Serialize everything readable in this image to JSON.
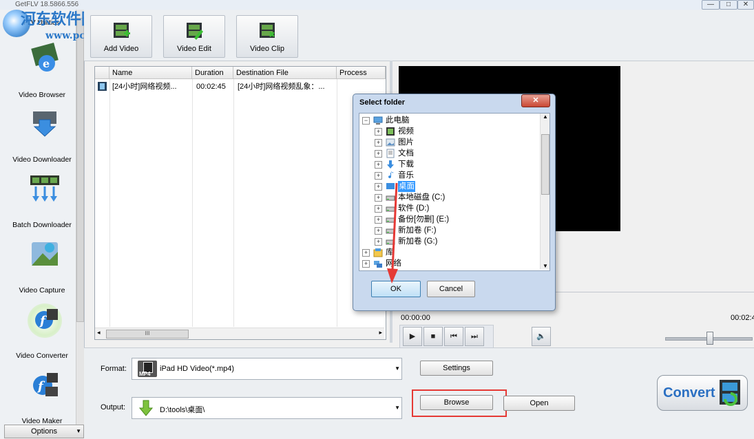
{
  "window": {
    "title": "GetFLV 18.5866.556",
    "watermark_cn": "河东软件园",
    "watermark_url": "www.pc0359.cn",
    "controls": [
      "—",
      "□",
      "✕"
    ]
  },
  "sidebar": {
    "header": "FLV Utilities",
    "items": [
      {
        "label": "Video Browser"
      },
      {
        "label": "Video Downloader"
      },
      {
        "label": "Batch Downloader"
      },
      {
        "label": "Video Capture"
      },
      {
        "label": "Video Converter"
      },
      {
        "label": "Video Maker"
      }
    ],
    "options_label": "Options"
  },
  "toolbar": {
    "add_video": "Add Video",
    "video_edit": "Video Edit",
    "video_clip": "Video Clip"
  },
  "list": {
    "columns": [
      "Name",
      "Duration",
      "Destination File",
      "Process"
    ],
    "rows": [
      {
        "name": "[24小时]网络视频...",
        "duration": "00:02:45",
        "dest": "[24小时]网络视频乱象：...",
        "process": ""
      }
    ],
    "scroll_grip": "III"
  },
  "player": {
    "time_start": "00:00:00",
    "time_end": "00:02:4"
  },
  "bottom": {
    "format_label": "Format:",
    "format_value": "iPad HD Video(*.mp4)",
    "format_icon_text": "MP4",
    "settings_label": "Settings",
    "output_label": "Output:",
    "output_value": "D:\\tools\\桌面\\",
    "browse_label": "Browse",
    "open_label": "Open",
    "convert_label": "Convert"
  },
  "dialog": {
    "title": "Select folder",
    "close": "✕",
    "tree": [
      {
        "label": "此电脑",
        "level": 0,
        "icon": "computer-icon"
      },
      {
        "label": "视频",
        "level": 1,
        "icon": "video-folder-icon"
      },
      {
        "label": "图片",
        "level": 1,
        "icon": "pictures-folder-icon"
      },
      {
        "label": "文档",
        "level": 1,
        "icon": "documents-folder-icon"
      },
      {
        "label": "下载",
        "level": 1,
        "icon": "downloads-folder-icon"
      },
      {
        "label": "音乐",
        "level": 1,
        "icon": "music-folder-icon"
      },
      {
        "label": "桌面",
        "level": 1,
        "icon": "desktop-folder-icon",
        "selected": true
      },
      {
        "label": "本地磁盘 (C:)",
        "level": 1,
        "icon": "drive-icon"
      },
      {
        "label": "软件 (D:)",
        "level": 1,
        "icon": "drive-icon"
      },
      {
        "label": "备份[勿删] (E:)",
        "level": 1,
        "icon": "drive-icon"
      },
      {
        "label": "新加卷 (F:)",
        "level": 1,
        "icon": "drive-icon"
      },
      {
        "label": "新加卷 (G:)",
        "level": 1,
        "icon": "drive-icon"
      },
      {
        "label": "库",
        "level": 0,
        "icon": "library-icon"
      },
      {
        "label": "网络",
        "level": 0,
        "icon": "network-icon"
      }
    ],
    "ok_label": "OK",
    "cancel_label": "Cancel"
  },
  "colors": {
    "accent_red": "#e53935",
    "selection": "#3399ff",
    "convert_text": "#2a6fc2"
  }
}
